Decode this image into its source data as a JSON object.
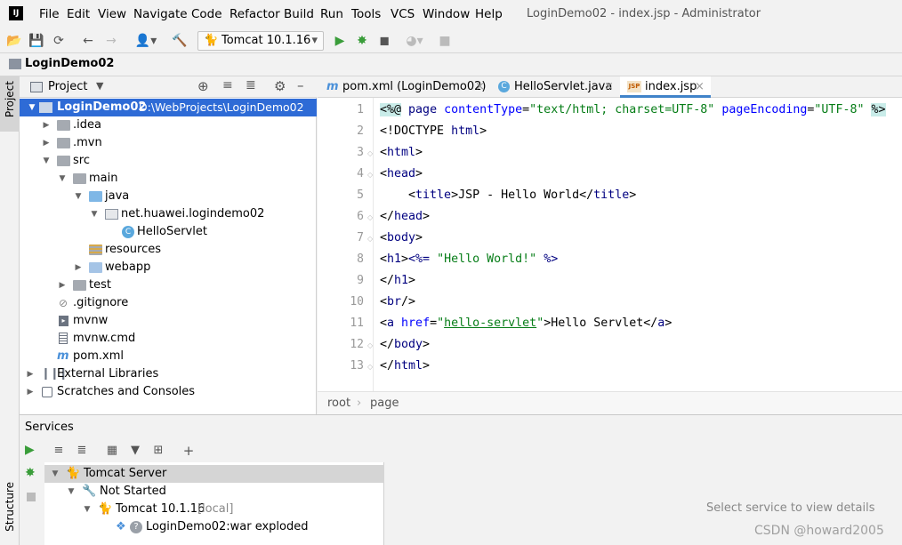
{
  "window": {
    "title": "LoginDemo02 - index.jsp - Administrator",
    "logo_text": "IJ"
  },
  "menu": [
    "File",
    "Edit",
    "View",
    "Navigate",
    "Code",
    "Refactor",
    "Build",
    "Run",
    "Tools",
    "VCS",
    "Window",
    "Help"
  ],
  "toolbar": {
    "run_config": "Tomcat 10.1.16"
  },
  "navbar": {
    "project_label": "LoginDemo02"
  },
  "side_tabs": {
    "project": "Project",
    "structure": "Structure"
  },
  "project_panel": {
    "header": "Project",
    "tree": [
      {
        "label": "LoginDemo02",
        "extra": "D:\\WebProjects\\LoginDemo02",
        "depth": 0,
        "expanded": true,
        "icon": "module-folder-icon",
        "selected": true
      },
      {
        "label": ".idea",
        "depth": 1,
        "expanded": false,
        "icon": "folder-icon"
      },
      {
        "label": ".mvn",
        "depth": 1,
        "expanded": false,
        "icon": "folder-icon"
      },
      {
        "label": "src",
        "depth": 1,
        "expanded": true,
        "icon": "folder-icon"
      },
      {
        "label": "main",
        "depth": 2,
        "expanded": true,
        "icon": "folder-icon"
      },
      {
        "label": "java",
        "depth": 3,
        "expanded": true,
        "icon": "source-folder-icon"
      },
      {
        "label": "net.huawei.logindemo02",
        "depth": 4,
        "expanded": true,
        "icon": "package-icon"
      },
      {
        "label": "HelloServlet",
        "depth": 5,
        "icon": "java-class-icon"
      },
      {
        "label": "resources",
        "depth": 3,
        "icon": "resources-folder-icon"
      },
      {
        "label": "webapp",
        "depth": 3,
        "expanded": false,
        "icon": "web-folder-icon"
      },
      {
        "label": "test",
        "depth": 2,
        "expanded": false,
        "icon": "folder-icon"
      },
      {
        "label": ".gitignore",
        "depth": 1,
        "icon": "gitignore-file-icon"
      },
      {
        "label": "mvnw",
        "depth": 1,
        "icon": "script-file-icon"
      },
      {
        "label": "mvnw.cmd",
        "depth": 1,
        "icon": "text-file-icon"
      },
      {
        "label": "pom.xml",
        "depth": 1,
        "icon": "maven-icon"
      },
      {
        "label": "External Libraries",
        "depth": 0,
        "expanded": false,
        "icon": "libraries-icon"
      },
      {
        "label": "Scratches and Consoles",
        "depth": 0,
        "expanded": false,
        "icon": "scratches-icon"
      }
    ]
  },
  "editor": {
    "tabs": [
      {
        "label": "pom.xml (LoginDemo02)",
        "icon": "maven-icon",
        "active": false
      },
      {
        "label": "HelloServlet.java",
        "icon": "java-class-icon",
        "active": false
      },
      {
        "label": "index.jsp",
        "icon": "jsp-file-icon",
        "active": true
      }
    ],
    "line_numbers": [
      "1",
      "2",
      "3",
      "4",
      "5",
      "6",
      "7",
      "8",
      "9",
      "10",
      "11",
      "12",
      "13"
    ],
    "breadcrumbs": [
      "root",
      "page"
    ]
  },
  "services": {
    "header": "Services",
    "tree": [
      {
        "label": "Tomcat Server",
        "depth": 0,
        "expanded": true,
        "icon": "tomcat-icon",
        "selected": true
      },
      {
        "label": "Not Started",
        "depth": 1,
        "expanded": true,
        "icon": "wrench-icon"
      },
      {
        "label": "Tomcat 10.1.16",
        "suffix": "[local]",
        "depth": 2,
        "expanded": true,
        "icon": "tomcat-icon"
      },
      {
        "label": "LoginDemo02:war exploded",
        "depth": 3,
        "icon": "artifact-icon"
      }
    ],
    "empty_detail": "Select service to view details"
  },
  "watermark": "CSDN @howard2005",
  "colors": {
    "selection": "#2e6bd6",
    "active_tab_underline": "#4083c9",
    "run_green": "#3a9d3a",
    "jsp_highlight": "#c9ece9"
  }
}
